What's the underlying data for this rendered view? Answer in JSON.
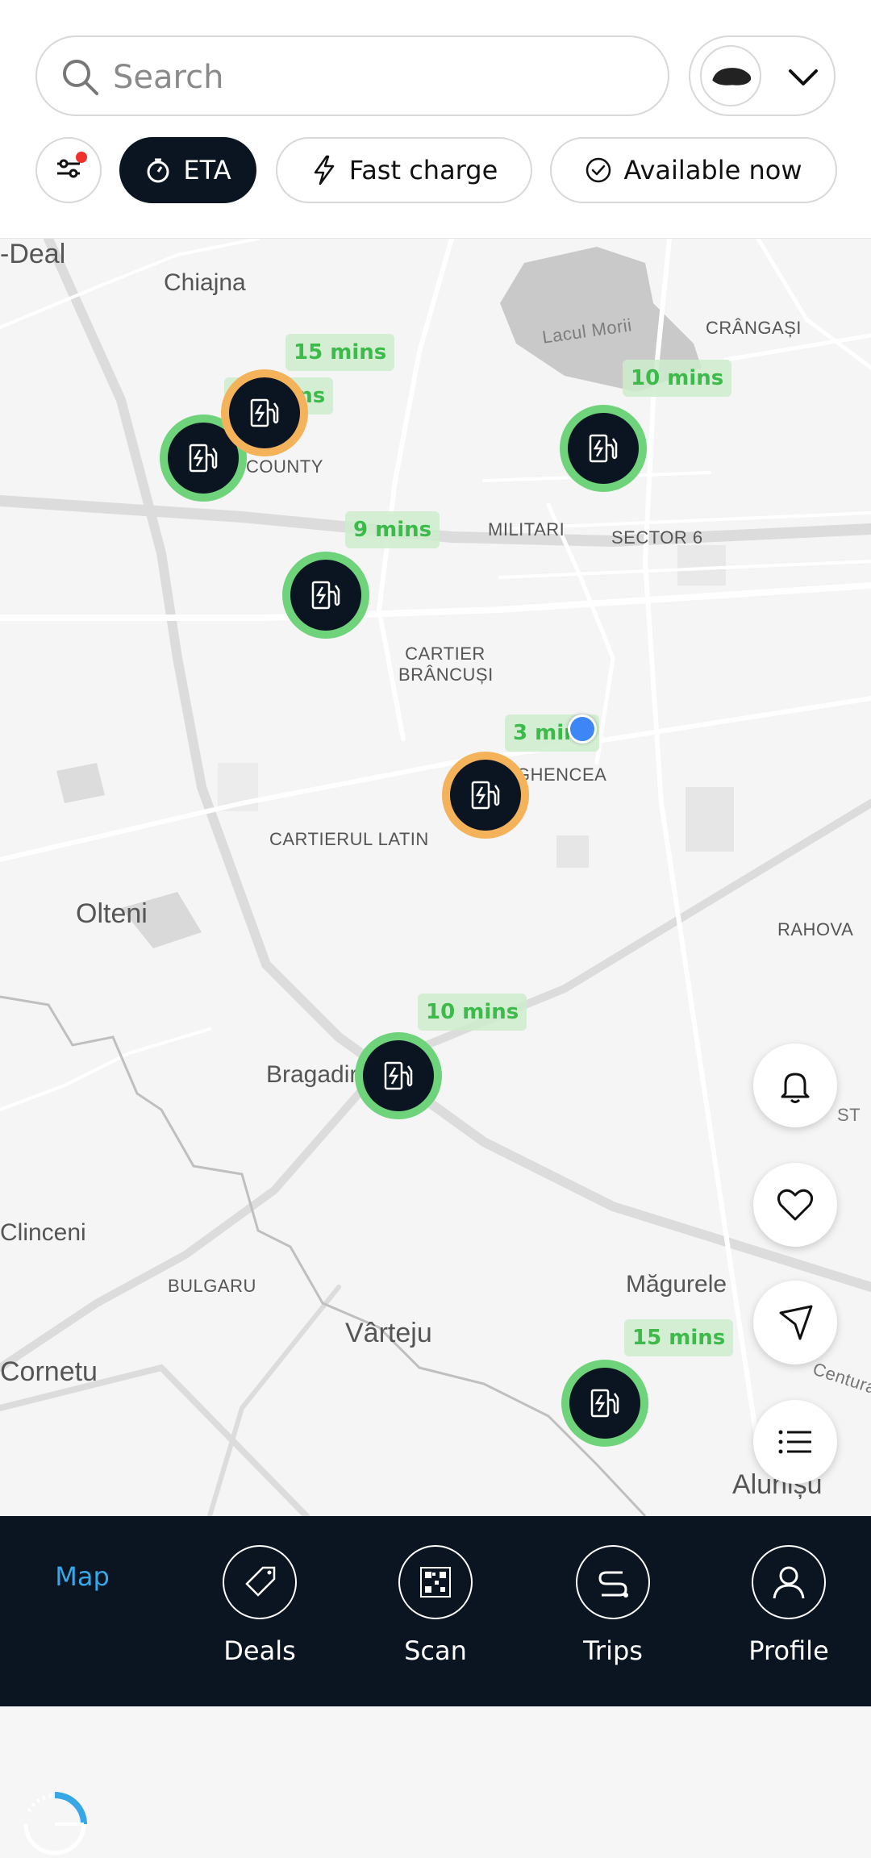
{
  "search": {
    "placeholder": "Search"
  },
  "vehicle": {
    "icon": "car-icon"
  },
  "filters": {
    "filter_icon": "sliders-icon",
    "eta_label": "ETA",
    "fast_charge_label": "Fast charge",
    "available_now_label": "Available now"
  },
  "map": {
    "places": [
      "-Deal",
      "Chiajna",
      "Lacul Morii",
      "CRÂNGAȘI",
      "COUNTY",
      "MILITARI",
      "SECTOR 6",
      "CARTIER",
      "BRÂNCUȘI",
      "GHENCEA",
      "CARTIERUL LATIN",
      "Olteni",
      "RAHOVA",
      "Bragadir",
      "Clinceni",
      "BULGARU",
      "Măgurele",
      "Vârteju",
      "Cornetu",
      "Alunișu",
      "Centura B",
      "ST"
    ],
    "stations": [
      {
        "eta": "15 mins",
        "status": "available"
      },
      {
        "eta": "18 mins",
        "status": "busy"
      },
      {
        "eta": "10 mins",
        "status": "available"
      },
      {
        "eta": "9 mins",
        "status": "available"
      },
      {
        "eta": "3 mins",
        "status": "busy"
      },
      {
        "eta": "10 mins",
        "status": "available"
      },
      {
        "eta": "15 mins",
        "status": "available"
      }
    ],
    "colors": {
      "available": "#6ed37a",
      "busy": "#f4b35a"
    }
  },
  "fabs": [
    "bell-icon",
    "heart-icon",
    "navigate-icon",
    "list-icon"
  ],
  "nav": {
    "items": [
      {
        "label": "Map",
        "active": true
      },
      {
        "label": "Deals",
        "active": false
      },
      {
        "label": "Scan",
        "active": false
      },
      {
        "label": "Trips",
        "active": false
      },
      {
        "label": "Profile",
        "active": false
      }
    ],
    "active_color": "#38a7e8"
  }
}
